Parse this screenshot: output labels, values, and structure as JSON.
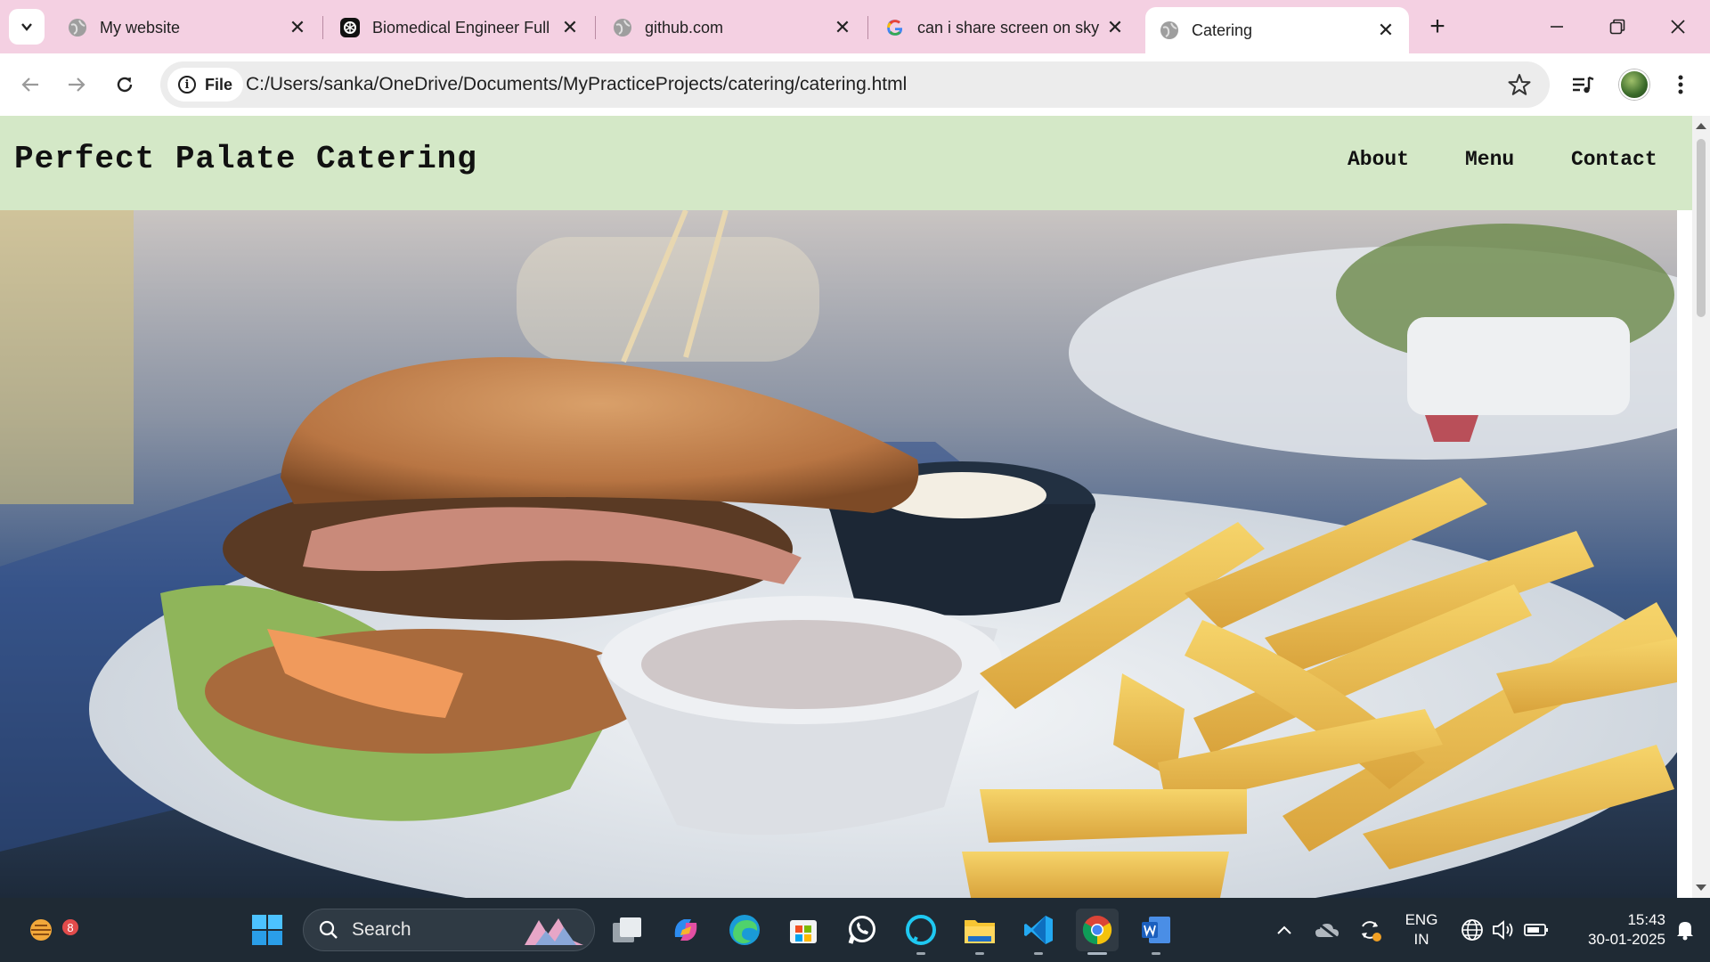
{
  "browser": {
    "tabs": [
      {
        "title": "My website",
        "favicon": "globe-icon"
      },
      {
        "title": "Biomedical Engineer Full",
        "favicon": "chatgpt-icon"
      },
      {
        "title": "github.com",
        "favicon": "globe-icon"
      },
      {
        "title": "can i share screen on sky",
        "favicon": "google-icon"
      },
      {
        "title": "Catering",
        "favicon": "globe-icon",
        "active": true
      }
    ],
    "address": {
      "chip_label": "File",
      "url": "C:/Users/sanka/OneDrive/Documents/MyPracticeProjects/catering/catering.html"
    }
  },
  "site": {
    "brand": "Perfect Palate Catering",
    "nav": {
      "about": "About",
      "menu": "Menu",
      "contact": "Contact"
    },
    "header_color": "#d4e8c7"
  },
  "taskbar": {
    "weather_badge": "8",
    "search_label": "Search",
    "language_line1": "ENG",
    "language_line2": "IN",
    "time": "15:43",
    "date": "30-01-2025",
    "apps": [
      "windows-start-icon",
      "task-view-icon",
      "copilot-icon",
      "edge-icon",
      "microsoft-store-icon",
      "whatsapp-icon",
      "alexa-icon",
      "file-explorer-icon",
      "vscode-icon",
      "chrome-icon",
      "word-icon"
    ]
  }
}
